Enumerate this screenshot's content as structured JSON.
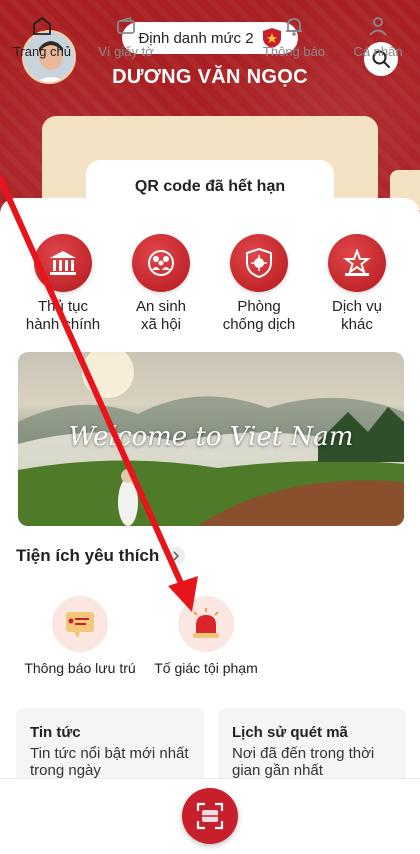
{
  "header": {
    "level_label": "Định danh mức 2",
    "user_name": "DƯƠNG VĂN NGỌC",
    "qr_status": "QR code đã hết hạn"
  },
  "services": [
    {
      "label": "Thủ tục\nhành chính",
      "icon": "government-building-icon"
    },
    {
      "label": "An sinh\nxã hội",
      "icon": "family-icon"
    },
    {
      "label": "Phòng\nchống dịch",
      "icon": "virus-shield-icon"
    },
    {
      "label": "Dịch vụ\nkhác",
      "icon": "star-podium-icon"
    }
  ],
  "banner": {
    "text": "Welcome to Viet Nam"
  },
  "favorites": {
    "title": "Tiện ích yêu thích",
    "items": [
      {
        "label": "Thông báo lưu trú",
        "icon": "notice-board-icon"
      },
      {
        "label": "Tố giác tội phạm",
        "icon": "siren-icon"
      }
    ]
  },
  "news": [
    {
      "title": "Tin tức",
      "desc": "Tin tức nổi bật mới nhất trong ngày"
    },
    {
      "title": "Lịch sử quét mã",
      "desc": "Nơi đã đến trong thời gian gần nhất"
    }
  ],
  "nav": {
    "home": "Trang chủ",
    "wallet": "Ví giấy tờ",
    "notifications": "Thông báo",
    "profile": "Cá nhân"
  },
  "colors": {
    "brand_red": "#a91f22",
    "accent_red": "#c8202a",
    "arrow_red": "#e8141b"
  }
}
